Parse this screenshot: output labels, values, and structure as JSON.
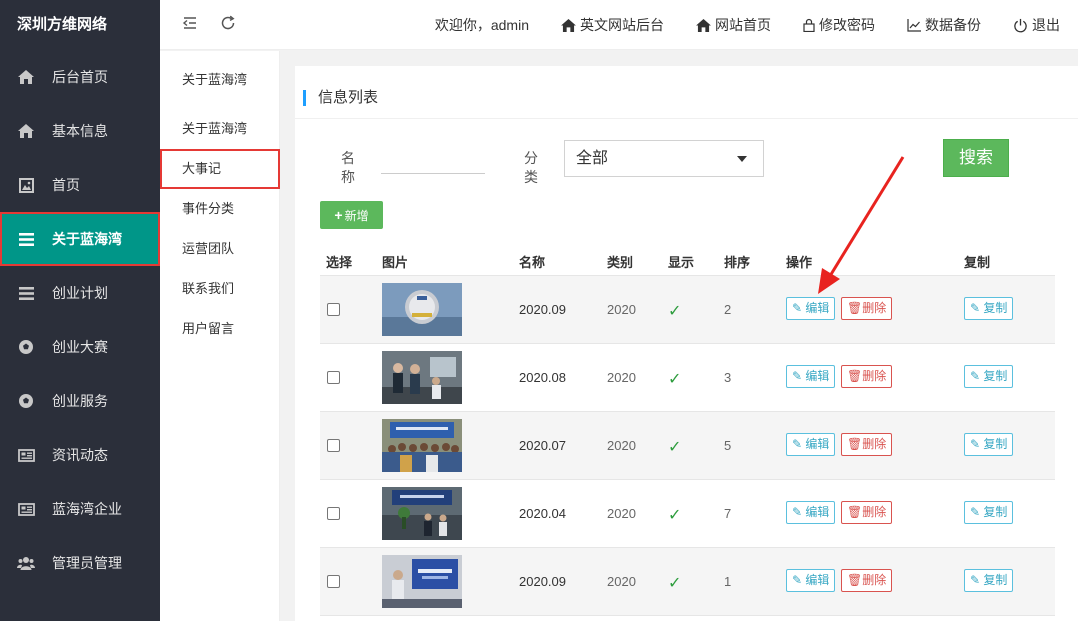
{
  "brand": "深圳方维网络",
  "sidebar": {
    "items": [
      {
        "label": "后台首页",
        "icon": "home-icon"
      },
      {
        "label": "基本信息",
        "icon": "home-icon"
      },
      {
        "label": "首页",
        "icon": "image-icon"
      },
      {
        "label": "关于蓝海湾",
        "icon": "list-icon",
        "active": true
      },
      {
        "label": "创业计划",
        "icon": "list-icon"
      },
      {
        "label": "创业大赛",
        "icon": "soccer-ball-icon"
      },
      {
        "label": "创业服务",
        "icon": "soccer-ball-icon"
      },
      {
        "label": "资讯动态",
        "icon": "newspaper-icon"
      },
      {
        "label": "蓝海湾企业",
        "icon": "newspaper-icon"
      },
      {
        "label": "管理员管理",
        "icon": "users-icon"
      }
    ]
  },
  "topbar": {
    "welcome": "欢迎你，admin",
    "english_backend": "英文网站后台",
    "site_home": "网站首页",
    "change_password": "修改密码",
    "data_backup": "数据备份",
    "logout": "退出"
  },
  "submenu": {
    "header": "关于蓝海湾",
    "items": [
      "关于蓝海湾",
      "大事记",
      "事件分类",
      "运营团队",
      "联系我们",
      "用户留言"
    ],
    "current": "大事记"
  },
  "panel": {
    "title": "信息列表",
    "filter": {
      "name_label_1": "名",
      "name_label_2": "称",
      "name_value": "",
      "category_label_1": "分",
      "category_label_2": "类",
      "category_selected": "全部",
      "search_label": "搜索"
    },
    "add_label": "新增"
  },
  "table": {
    "headers": {
      "select": "选择",
      "image": "图片",
      "name": "名称",
      "category": "类别",
      "display": "显示",
      "order": "排序",
      "actions": "操作",
      "copy": "复制"
    },
    "edit_label": "编辑",
    "delete_label": "删除",
    "copy_label": "复制",
    "rows": [
      {
        "name": "2020.09",
        "category": "2020",
        "display": "✓",
        "order": "2"
      },
      {
        "name": "2020.08",
        "category": "2020",
        "display": "✓",
        "order": "3"
      },
      {
        "name": "2020.07",
        "category": "2020",
        "display": "✓",
        "order": "5"
      },
      {
        "name": "2020.04",
        "category": "2020",
        "display": "✓",
        "order": "7"
      },
      {
        "name": "2020.09",
        "category": "2020",
        "display": "✓",
        "order": "1"
      }
    ]
  },
  "colors": {
    "sidebar_bg": "#2b2f3a",
    "active_nav": "#009688",
    "highlight_border": "#e53935",
    "success_green": "#5cb85c",
    "info_blue": "#5bc0de",
    "danger_red": "#d9534f",
    "arrow_red": "#e8231f"
  }
}
